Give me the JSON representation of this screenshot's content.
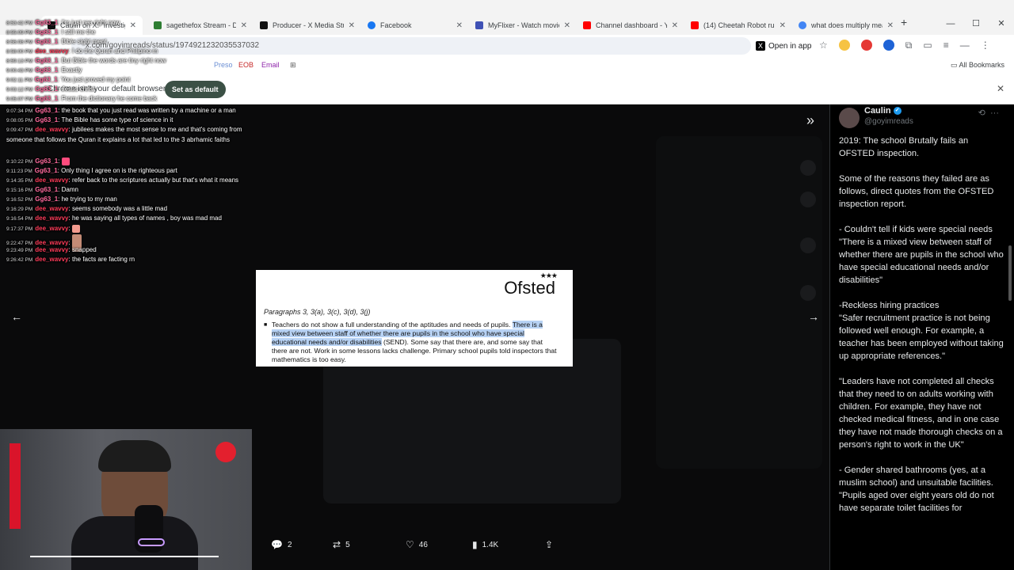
{
  "browser": {
    "tabs": [
      {
        "label": "Caulin on X: \"Investigati",
        "color": "#111111",
        "active": true
      },
      {
        "label": "sagethefox Stream - Dis",
        "color": "#2e7d32"
      },
      {
        "label": "Producer - X Media Stud",
        "color": "#111111"
      },
      {
        "label": "Facebook",
        "color": "#1877f2"
      },
      {
        "label": "MyFlixer - Watch movies",
        "color": "#3f51b5"
      },
      {
        "label": "Channel dashboard - You",
        "color": "#ff0000"
      },
      {
        "label": "(14) Cheetah Robot runs",
        "color": "#ff0000"
      },
      {
        "label": "what does multiply mea",
        "color": "#4285f4"
      }
    ],
    "url": "x.com/goyimreads/status/1974921232035537032",
    "open_in_app": "Open in app",
    "bookmarks": [
      "Preso",
      "EOB",
      "Email"
    ],
    "all_bookmarks": "All Bookmarks",
    "infobar_message": "Chrome isn't your default browser",
    "set_default": "Set as default"
  },
  "chat": {
    "lines": [
      {
        "time": "8:53:42 PM",
        "user": "Gg63_1",
        "text": "I'm just rea right now"
      },
      {
        "time": "8:55:09 PM",
        "user": "Gg63_1",
        "text": "I still me the"
      },
      {
        "time": "8:56:08 PM",
        "user": "Gg63_1",
        "text": "Bible sight ment"
      },
      {
        "time": "8:58:00 PM",
        "user": "dee_wavvy",
        "text": "I do the Quran and Philipino m"
      },
      {
        "time": "8:59:13 PM",
        "user": "Gg63_1",
        "text": "But Bible the words are tiny right now"
      },
      {
        "time": "9:00:43 PM",
        "user": "Gg63_1",
        "text": "Exactly"
      },
      {
        "time": "9:02:11 PM",
        "user": "Gg63_1",
        "text": "You just proved my point"
      },
      {
        "time": "9:03:12 PM",
        "user": "Gg63_1",
        "text": "Jesus christ"
      },
      {
        "time": "9:05:07 PM",
        "user": "Gg63_1",
        "text": "From the dictionary he come back"
      },
      {
        "time": "9:07:34 PM",
        "user": "Gg63_1",
        "text": "the book that you just read was written by a machine or a man"
      },
      {
        "time": "9:08:05 PM",
        "user": "Gg63_1",
        "text": "The Bible has some type of science in it"
      },
      {
        "time": "9:09:47 PM",
        "user": "dee_wavvy",
        "text": "jubilees makes the most sense to me and that's coming from someone that follows the Quran it explains a lot that led to the 3 abrhamic faiths"
      },
      {
        "time": "9:10:22 PM",
        "user": "Gg63_1",
        "text": ""
      },
      {
        "time": "9:11:23 PM",
        "user": "Gg63_1",
        "text": "Only thing I agree on is the righteous part"
      },
      {
        "time": "9:14:35 PM",
        "user": "dee_wavvy",
        "text": "refer back to the scriptures actually but that's what it means"
      },
      {
        "time": "9:15:16 PM",
        "user": "Gg63_1",
        "text": "Damn"
      },
      {
        "time": "9:16:52 PM",
        "user": "Gg63_1",
        "text": "he trying to my man"
      },
      {
        "time": "9:16:29 PM",
        "user": "dee_wavvy",
        "text": "seems somebody was a little mad"
      },
      {
        "time": "9:16:54 PM",
        "user": "dee_wavvy",
        "text": "he was saying all types of names , boy was mad mad"
      },
      {
        "time": "9:17:37 PM",
        "user": "dee_wavvy",
        "text": ""
      },
      {
        "time": "9:22:47 PM",
        "user": "dee_wavvy",
        "text": ""
      },
      {
        "time": "9:23:49 PM",
        "user": "dee_wavvy",
        "text": "snapped"
      },
      {
        "time": "9:26:42 PM",
        "user": "dee_wavvy",
        "text": "the facts are facting rn"
      }
    ]
  },
  "media": {
    "logo": "Ofsted",
    "paragraph_refs": "Paragraphs 3, 3(a), 3(c), 3(d), 3(j)",
    "text_pre": "Teachers do not show a full understanding of the aptitudes and needs of pupils.",
    "text_highlight": "There is a mixed view between staff of whether there are pupils in the school who have special educational needs and/or disabilities",
    "text_post": "(SEND). Some say that there are, and some say that there are not. Work in some lessons lacks challenge. Primary school pupils told inspectors that mathematics is too easy."
  },
  "post_actions": {
    "replies": "2",
    "reposts": "5",
    "likes": "46",
    "views": "1.4K"
  },
  "thread": {
    "name": "Caulin",
    "handle": "@goyimreads",
    "paragraphs": [
      "2019: The school Brutally fails an OFSTED inspection.",
      "Some of the reasons they failed are as follows, direct quotes from the OFSTED inspection report.",
      "- Couldn't tell if kids were special needs\n\"There is a mixed view between staff of whether there are pupils in the school who have special educational needs and/or disabilities\"",
      "-Reckless hiring practices\n\"Safer recruitment practice is not being followed well enough. For example, a teacher has been employed without taking up appropriate references.\"",
      "\"Leaders have not completed all checks that they need to on adults working with children. For example, they have not checked medical fitness, and in one case they have not made thorough checks on a person's right to work in the UK\"",
      "- Gender shared bathrooms (yes, at a muslim school) and unsuitable facilities.\n\"Pupils aged over eight years old do not have separate toilet facilities for"
    ]
  },
  "colors": {
    "accent_blue": "#1d9bf0",
    "highlight": "#b7d2f4",
    "chat_user_gg": "#ff6a9d",
    "chat_user_dee": "#ff3c5a"
  }
}
